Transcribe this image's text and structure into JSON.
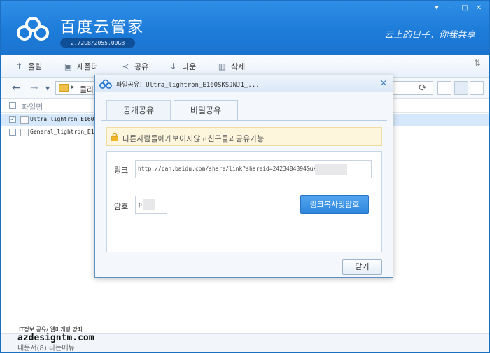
{
  "app": {
    "title": "百度云管家",
    "storage": "2.72GB/2055.00GB",
    "slogan": "云上的日子，你我共享"
  },
  "toolbar": {
    "upload": "올림",
    "new_folder": "새폴더",
    "share": "공유",
    "download": "다운",
    "delete": "삭제"
  },
  "address": {
    "path": "클라우"
  },
  "file_list": {
    "header": "파일명",
    "rows": [
      {
        "name": "Ultra_lightron_E160S",
        "checked": true
      },
      {
        "name": "General_lightron_E16",
        "checked": false
      }
    ]
  },
  "watermark": {
    "line1": "IT정보 공유/ 웹마케팅 강좌",
    "line2": "azdesigntm.com"
  },
  "status": {
    "text": "내문서(8) 라는메뉴"
  },
  "dialog": {
    "title": "파일공유：Ultra_lightron_E160SKSJNJ1_...",
    "tabs": [
      {
        "label": "공개공유",
        "active": false
      },
      {
        "label": "비밀공유",
        "active": true
      }
    ],
    "notice": "다른사람들에게보이지않고친구들과공유가능",
    "link_label": "링크",
    "link_value": "http://pan.baidu.com/share/link?shareid=2423484894&uk=",
    "password_label": "암호",
    "password_value": "p",
    "copy_button": "링크복사및암호",
    "close_button": "닫기"
  },
  "colors": {
    "titlebar": "#1d7bd9",
    "accent_button": "#3a92e4",
    "notice_bg": "#fdf6dc"
  }
}
